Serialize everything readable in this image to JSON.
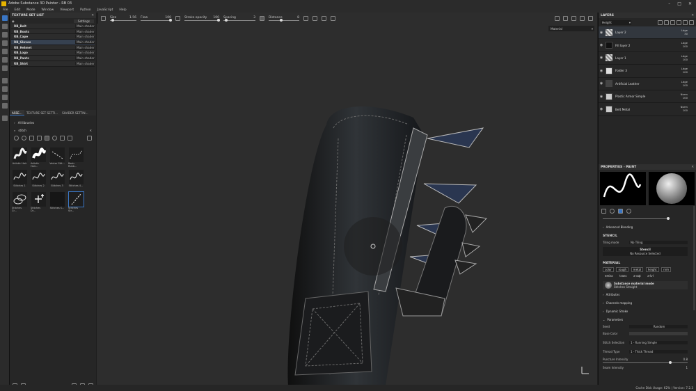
{
  "window": {
    "title": "Adobe Substance 3D Painter - RB 03"
  },
  "menu": [
    "File",
    "Edit",
    "Mode",
    "Window",
    "Viewport",
    "Python",
    "JavaScript",
    "Help"
  ],
  "toolbar": {
    "size_label": "Size",
    "size_value": "1.56",
    "flow_label": "Flow",
    "flow_value": "100",
    "stroke_opacity_label": "Stroke opacity",
    "stroke_opacity_value": "100",
    "spacing_label": "Spacing",
    "spacing_value": "3",
    "distance_label": "Distance",
    "distance_value": "8"
  },
  "texture_set_list": {
    "title": "TEXTURE SET LIST",
    "settings": "Settings",
    "items": [
      {
        "name": "RB_Belt",
        "shader": "Main shader"
      },
      {
        "name": "RB_Boots",
        "shader": "Main shader"
      },
      {
        "name": "RB_Cape",
        "shader": "Main shader"
      },
      {
        "name": "RB_Gloves",
        "shader": "Main shader"
      },
      {
        "name": "RB_Helmet",
        "shader": "Main shader"
      },
      {
        "name": "RB_Logo",
        "shader": "Main shader"
      },
      {
        "name": "RB_Pants",
        "shader": "Main shader"
      },
      {
        "name": "RB_Shirt",
        "shader": "Main shader"
      }
    ]
  },
  "assets": {
    "tabs": [
      "ASSE...",
      "TEXTURE SET SETTI...",
      "SHADER SETTIN..."
    ],
    "library": "All libraries",
    "search": "stitch",
    "tiles": [
      "Artistic Hair",
      "Artistic Hair...",
      "Vector Stit...",
      "Basic Rubb...",
      "Stitches 1",
      "Stitches 2",
      "Stitches 3",
      "Stitches 4...",
      "Stitches Cr...",
      "Stitches Dr...",
      "Stitches S...",
      "Stitches Str..."
    ]
  },
  "viewport": {
    "mode": "Material"
  },
  "layers": {
    "title": "LAYERS",
    "channel": "Height",
    "items": [
      {
        "name": "Layer 2",
        "blend": "Ldge",
        "opacity": "30"
      },
      {
        "name": "Fill layer 2",
        "blend": "Ldge",
        "opacity": "100"
      },
      {
        "name": "Layer 1",
        "blend": "Ldge",
        "opacity": "100"
      },
      {
        "name": "Folder 3",
        "blend": "Ldge",
        "opacity": "100"
      },
      {
        "name": "Artificial Leather",
        "blend": "Ldge",
        "opacity": "100"
      },
      {
        "name": "Plastic Armor Simple",
        "blend": "Norm",
        "opacity": "100"
      },
      {
        "name": "Belt Metal",
        "blend": "Norm",
        "opacity": "100"
      }
    ]
  },
  "properties": {
    "title": "PROPERTIES - PAINT",
    "advanced_blending": "Advanced Blending",
    "stencil_heading": "STENCIL",
    "tiling_mode_label": "Tiling mode",
    "tiling_mode_value": "No Tiling",
    "stencil_label": "Stencil",
    "stencil_value": "No Resource Selected",
    "material_heading": "MATERIAL",
    "channels": [
      "color",
      "rough",
      "metal",
      "height",
      "nrm",
      "emiss",
      "trans",
      "a-oqt",
      "a-lvl"
    ],
    "material_mode": "Substance material mode",
    "material_name": "Stitches Straight",
    "sections": [
      "Attributes",
      "Channels mapping",
      "Dynamic Stroke",
      "Parameters"
    ],
    "params": [
      {
        "label": "Seed",
        "value": "Random"
      },
      {
        "label": "Base Color",
        "value": ""
      },
      {
        "label": "Stitch Selection",
        "value": "1 - Running Simple"
      },
      {
        "label": "Thread Type",
        "value": "1 - Thick Thread"
      },
      {
        "label": "Puncture Intensity",
        "value": "0.8"
      },
      {
        "label": "Seam Intensity",
        "value": "1"
      }
    ]
  },
  "status": {
    "text": "Cache Disk Usage:   62% | Version: 7.2.3"
  }
}
